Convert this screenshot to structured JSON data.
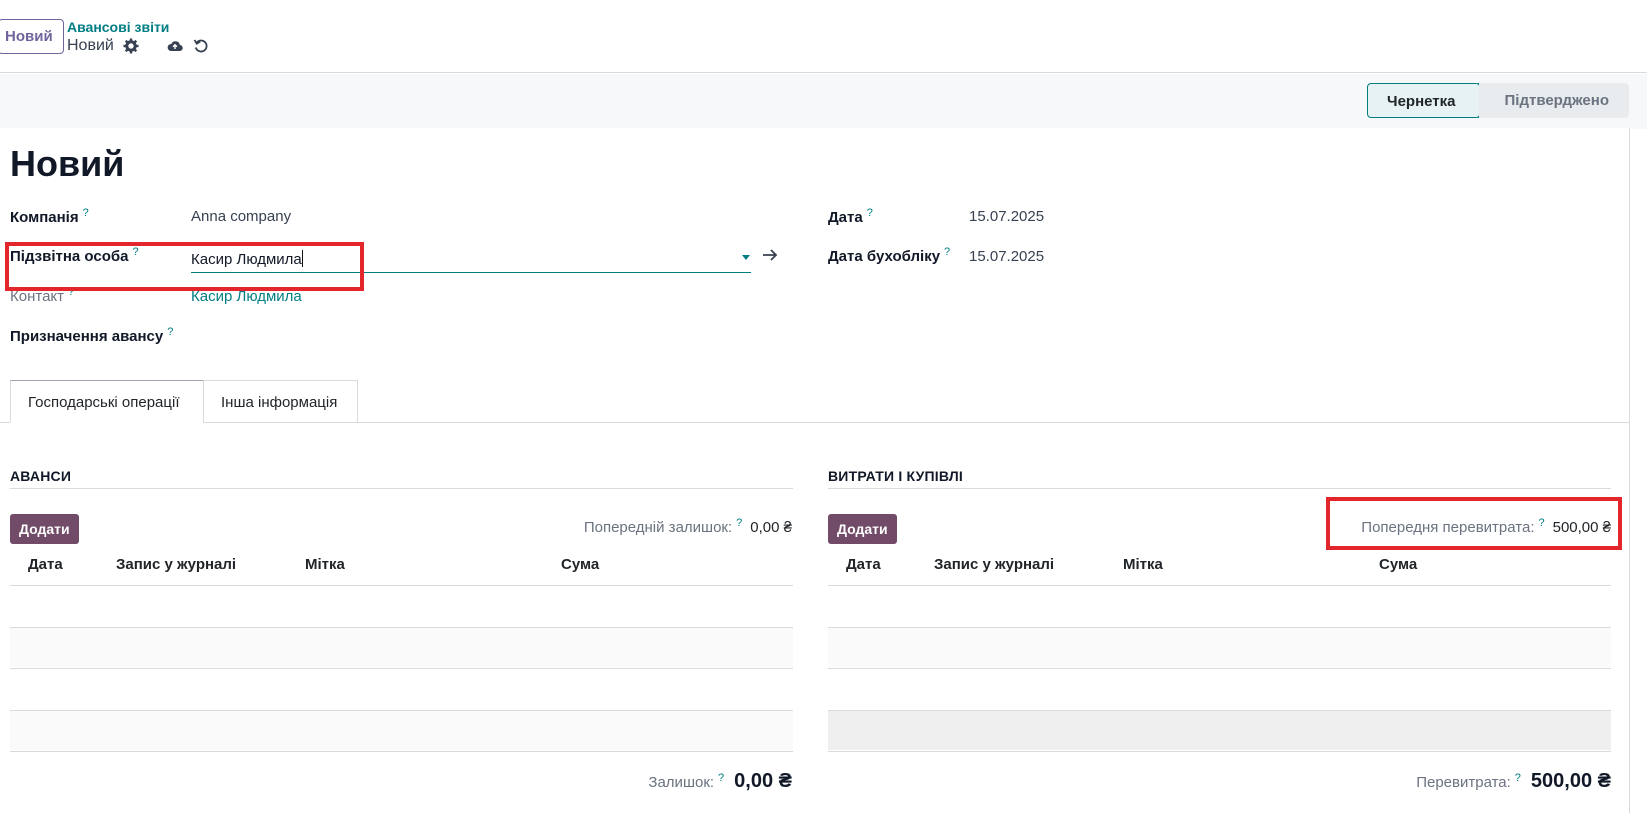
{
  "control_panel": {
    "new_button": "Новий",
    "breadcrumb": "Авансові звіти",
    "record_name": "Новий"
  },
  "statusbar": {
    "stages": [
      "Чернетка",
      "Підтверджено"
    ],
    "active": "Чернетка"
  },
  "form": {
    "title": "Новий",
    "help_mark": "?",
    "company_label": "Компанія",
    "company_value": "Anna company",
    "accountable_label": "Підзвітна особа",
    "accountable_value": "Касир Людмила",
    "contact_label": "Контакт",
    "contact_value": "Касир Людмила",
    "purpose_label": "Призначення авансу",
    "date_label": "Дата",
    "date_value": "15.07.2025",
    "acc_date_label": "Дата бухобліку",
    "acc_date_value": "15.07.2025"
  },
  "tabs": [
    "Господарські операції",
    "Інша інформація"
  ],
  "advances": {
    "title": "АВАНСИ",
    "add_label": "Додати",
    "prev_label": "Попередній залишок:",
    "prev_value": "0,00 ₴",
    "columns": [
      "Дата",
      "Запис у журналі",
      "Мітка",
      "Сума"
    ],
    "total_label": "Залишок:",
    "total_value": "0,00 ₴"
  },
  "expenses": {
    "title": "ВИТРАТИ І КУПІВЛІ",
    "add_label": "Додати",
    "prev_label": "Попередня перевитрата:",
    "prev_value": "500,00 ₴",
    "columns": [
      "Дата",
      "Запис у журналі",
      "Мітка",
      "Сума"
    ],
    "total_label": "Перевитрата:",
    "total_value": "500,00 ₴"
  },
  "colors": {
    "primary": "#714b67",
    "accent": "#017e84",
    "highlight": "#e3262b"
  }
}
